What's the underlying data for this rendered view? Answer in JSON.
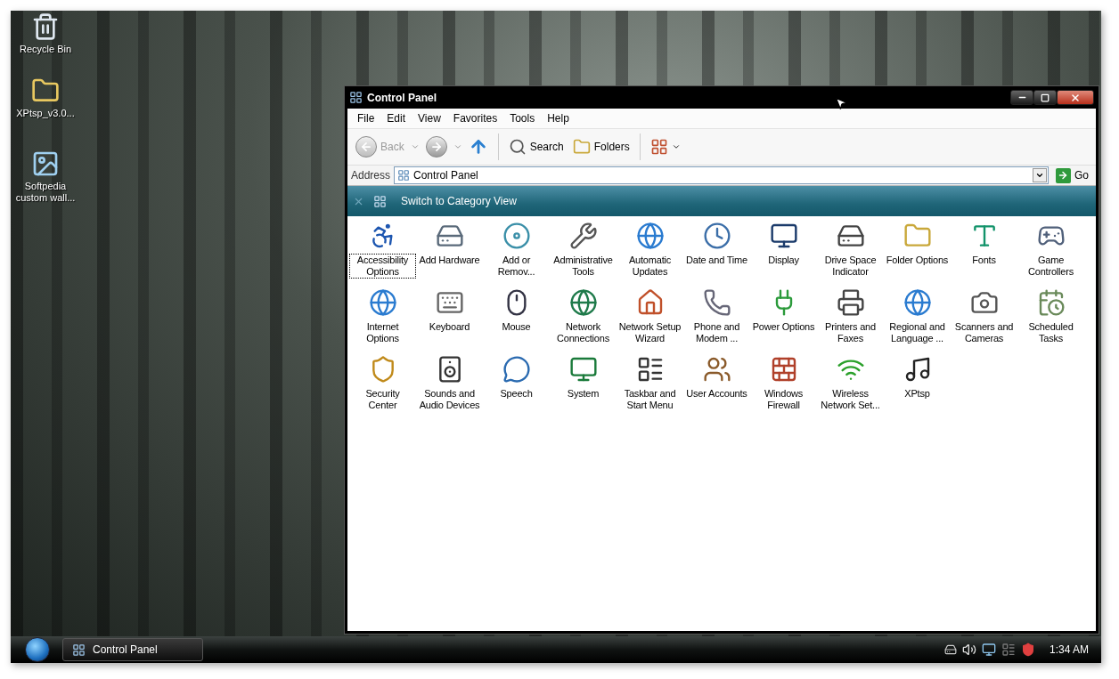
{
  "desktop": {
    "icons": [
      {
        "label": "Recycle Bin"
      },
      {
        "label": "XPtsp_v3.0..."
      },
      {
        "label": "Softpedia custom wall..."
      }
    ]
  },
  "window": {
    "title": "Control Panel",
    "menu": [
      {
        "label": "File"
      },
      {
        "label": "Edit"
      },
      {
        "label": "View"
      },
      {
        "label": "Favorites"
      },
      {
        "label": "Tools"
      },
      {
        "label": "Help"
      }
    ],
    "toolbar": {
      "back": {
        "label": "Back",
        "disabled": true
      },
      "search": "Search",
      "folders": "Folders"
    },
    "address": {
      "label": "Address",
      "value": "Control Panel",
      "go": "Go"
    },
    "banner": {
      "label": "Switch to Category View"
    },
    "items": [
      {
        "label": "Accessibility Options",
        "selected": true
      },
      {
        "label": "Add Hardware",
        "selected": false
      },
      {
        "label": "Add or Remov...",
        "selected": false
      },
      {
        "label": "Administrative Tools",
        "selected": false
      },
      {
        "label": "Automatic Updates",
        "selected": false
      },
      {
        "label": "Date and Time",
        "selected": false
      },
      {
        "label": "Display",
        "selected": false
      },
      {
        "label": "Drive Space Indicator",
        "selected": false
      },
      {
        "label": "Folder Options",
        "selected": false
      },
      {
        "label": "Fonts",
        "selected": false
      },
      {
        "label": "Game Controllers",
        "selected": false
      },
      {
        "label": "Internet Options",
        "selected": false
      },
      {
        "label": "Keyboard",
        "selected": false
      },
      {
        "label": "Mouse",
        "selected": false
      },
      {
        "label": "Network Connections",
        "selected": false
      },
      {
        "label": "Network Setup Wizard",
        "selected": false
      },
      {
        "label": "Phone and Modem ...",
        "selected": false
      },
      {
        "label": "Power Options",
        "selected": false
      },
      {
        "label": "Printers and Faxes",
        "selected": false
      },
      {
        "label": "Regional and Language ...",
        "selected": false
      },
      {
        "label": "Scanners and Cameras",
        "selected": false
      },
      {
        "label": "Scheduled Tasks",
        "selected": false
      },
      {
        "label": "Security Center",
        "selected": false
      },
      {
        "label": "Sounds and Audio Devices",
        "selected": false
      },
      {
        "label": "Speech",
        "selected": false
      },
      {
        "label": "System",
        "selected": false
      },
      {
        "label": "Taskbar and Start Menu",
        "selected": false
      },
      {
        "label": "User Accounts",
        "selected": false
      },
      {
        "label": "Windows Firewall",
        "selected": false
      },
      {
        "label": "Wireless Network Set...",
        "selected": false
      },
      {
        "label": "XPtsp",
        "selected": false
      }
    ]
  },
  "taskbar": {
    "buttons": [
      {
        "label": "Control Panel"
      }
    ],
    "clock": "1:34 AM"
  }
}
